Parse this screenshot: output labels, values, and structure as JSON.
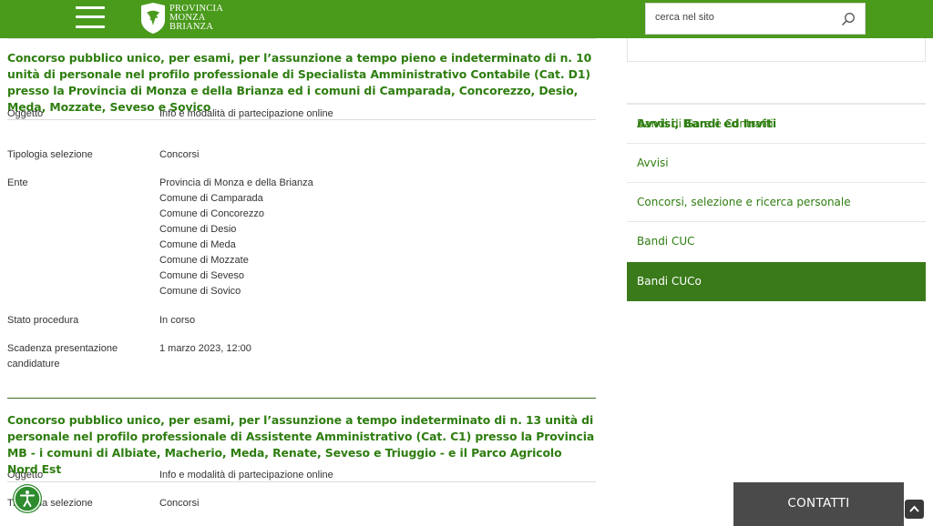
{
  "header": {
    "logo_lines": [
      "PROVINCIA",
      "MONZA",
      "BRIANZA"
    ],
    "search_placeholder": "cerca nel sito"
  },
  "notices": [
    {
      "title": "Concorso pubblico unico, per esami, per l’assunzione a tempo pieno e indeterminato di n. 10 unità di personale nel profilo professionale di Specialista Amministrativo Contabile (Cat. D1) presso la Provincia di Monza e della Brianza ed i comuni di Camparada, Concorezzo, Desio, Meda, Mozzate, Seveso e Sovico",
      "rows": [
        {
          "label": "Oggetto",
          "values": [
            "Info e modalità di partecipazione online"
          ]
        },
        {
          "label": "Tipologia selezione",
          "values": [
            "Concorsi"
          ]
        },
        {
          "label": "Ente",
          "values": [
            "Provincia di Monza e della Brianza",
            "Comune di Camparada",
            "Comune di Concorezzo",
            "Comune di Desio",
            "Comune di Meda",
            "Comune di Mozzate",
            "Comune di Seveso",
            "Comune di Sovico"
          ]
        },
        {
          "label": "Stato procedura",
          "values": [
            "In corso"
          ]
        },
        {
          "label": "Scadenza presentazione candidature",
          "values": [
            "1 marzo 2023, 12:00"
          ]
        }
      ]
    },
    {
      "title": "Concorso pubblico unico, per esami, per l’assunzione a tempo indeterminato di n. 13 unità di personale nel profilo professionale di Assistente Amministrativo (Cat. C1) presso la Provincia MB - i comuni di Albiate, Macherio, Meda, Renate, Seveso e Triuggio - e il Parco Agricolo Nord Est",
      "rows": [
        {
          "label": "Oggetto",
          "values": [
            "Info e modalità di partecipazione online"
          ]
        },
        {
          "label": "Tipologia selezione",
          "values": [
            "Concorsi"
          ]
        }
      ]
    }
  ],
  "sidebar": {
    "heading": "Avvisi, Bandi ed Inviti",
    "items": [
      {
        "label": "Bandi di Gara e Contratti",
        "active": false
      },
      {
        "label": "Avvisi",
        "active": false
      },
      {
        "label": "Concorsi, selezione e ricerca personale",
        "active": false
      },
      {
        "label": "Bandi CUC",
        "active": false
      },
      {
        "label": "Bandi CUCo",
        "active": true
      }
    ]
  },
  "contact_button": "CONTATTI",
  "colors": {
    "brand_green": "#4a9a1c",
    "title_green": "#2e7d10",
    "active_green": "#3a7a1a",
    "contact_gray": "#4a4a4a"
  },
  "icons": {
    "menu": "hamburger-icon",
    "search": "search-icon",
    "scroll_top": "chevron-up-icon",
    "accessibility": "accessibility-icon"
  }
}
